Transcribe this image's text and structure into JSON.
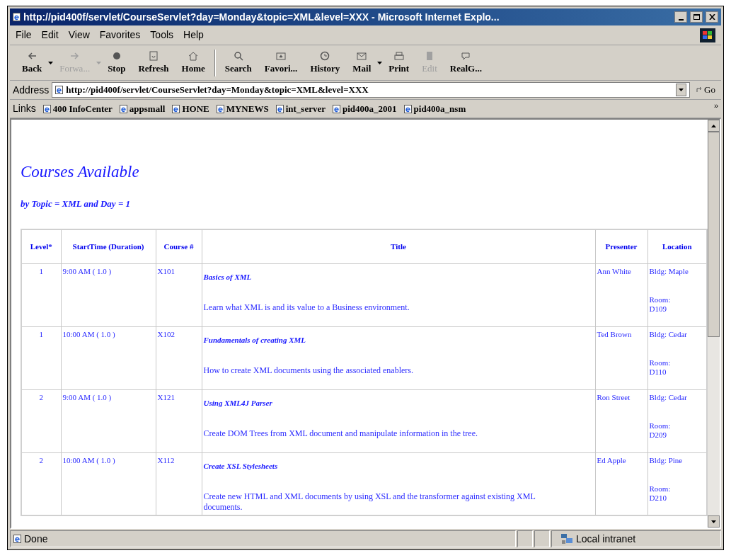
{
  "window": {
    "title": "http://pid400f/servlet/CourseServlet?day=Monday&topic=XML&level=XXX - Microsoft Internet Explo..."
  },
  "menu": [
    "File",
    "Edit",
    "View",
    "Favorites",
    "Tools",
    "Help"
  ],
  "toolbar": [
    {
      "label": "Back",
      "disabled": false,
      "dropdown": true
    },
    {
      "label": "Forwa...",
      "disabled": true,
      "dropdown": true
    },
    {
      "label": "Stop",
      "disabled": false,
      "dropdown": false
    },
    {
      "label": "Refresh",
      "disabled": false,
      "dropdown": false
    },
    {
      "label": "Home",
      "disabled": false,
      "dropdown": false,
      "separator_after": true
    },
    {
      "label": "Search",
      "disabled": false,
      "dropdown": false
    },
    {
      "label": "Favori...",
      "disabled": false,
      "dropdown": false
    },
    {
      "label": "History",
      "disabled": false,
      "dropdown": false
    },
    {
      "label": "Mail",
      "disabled": false,
      "dropdown": true
    },
    {
      "label": "Print",
      "disabled": false,
      "dropdown": false
    },
    {
      "label": "Edit",
      "disabled": true,
      "dropdown": false
    },
    {
      "label": "RealG...",
      "disabled": false,
      "dropdown": false
    }
  ],
  "address": {
    "label": "Address",
    "value": "http://pid400f/servlet/CourseServlet?day=Monday&topic=XML&level=XXX",
    "go": "Go"
  },
  "links": {
    "label": "Links",
    "items": [
      "400 InfoCenter",
      "appsmall",
      "HONE",
      "MYNEWS",
      "int_server",
      "pid400a_2001",
      "pid400a_nsm"
    ],
    "more": "»"
  },
  "page": {
    "heading": "Courses Available",
    "subheading": "by Topic = XML and Day = 1",
    "table": {
      "columns": [
        "Level*",
        "StartTime (Duration)",
        "Course #",
        "Title",
        "Presenter",
        "Location"
      ],
      "rows": [
        {
          "level": "1",
          "start": "9:00 AM ( 1.0 )",
          "course": "X101",
          "title": "Basics of XML",
          "description": "Learn what XML is and its value to a Business environment.",
          "presenter": "Ann White",
          "building": "Bldg: Maple",
          "room": "Room: D109"
        },
        {
          "level": "1",
          "start": "10:00 AM ( 1.0 )",
          "course": "X102",
          "title": "Fundamentals of creating XML",
          "description": "How to create XML documents using the associated enablers.",
          "presenter": "Ted Brown",
          "building": "Bldg: Cedar",
          "room": "Room: D110"
        },
        {
          "level": "2",
          "start": "9:00 AM ( 1.0 )",
          "course": "X121",
          "title": "Using XML4J Parser",
          "description": "Create DOM Trees from XML document and manipulate information in the tree.",
          "presenter": "Ron Street",
          "building": "Bldg: Cedar",
          "room": "Room: D209"
        },
        {
          "level": "2",
          "start": "10:00 AM ( 1.0 )",
          "course": "X112",
          "title": "Create XSL Stylesheets",
          "description": "Create new HTML and XML documents by using XSL and the transformer against existing XML documents.",
          "presenter": "Ed Apple",
          "building": "Bldg: Pine",
          "room": "Room: D210"
        }
      ]
    }
  },
  "status_bar": {
    "status": "Done",
    "zone": "Local intranet"
  }
}
